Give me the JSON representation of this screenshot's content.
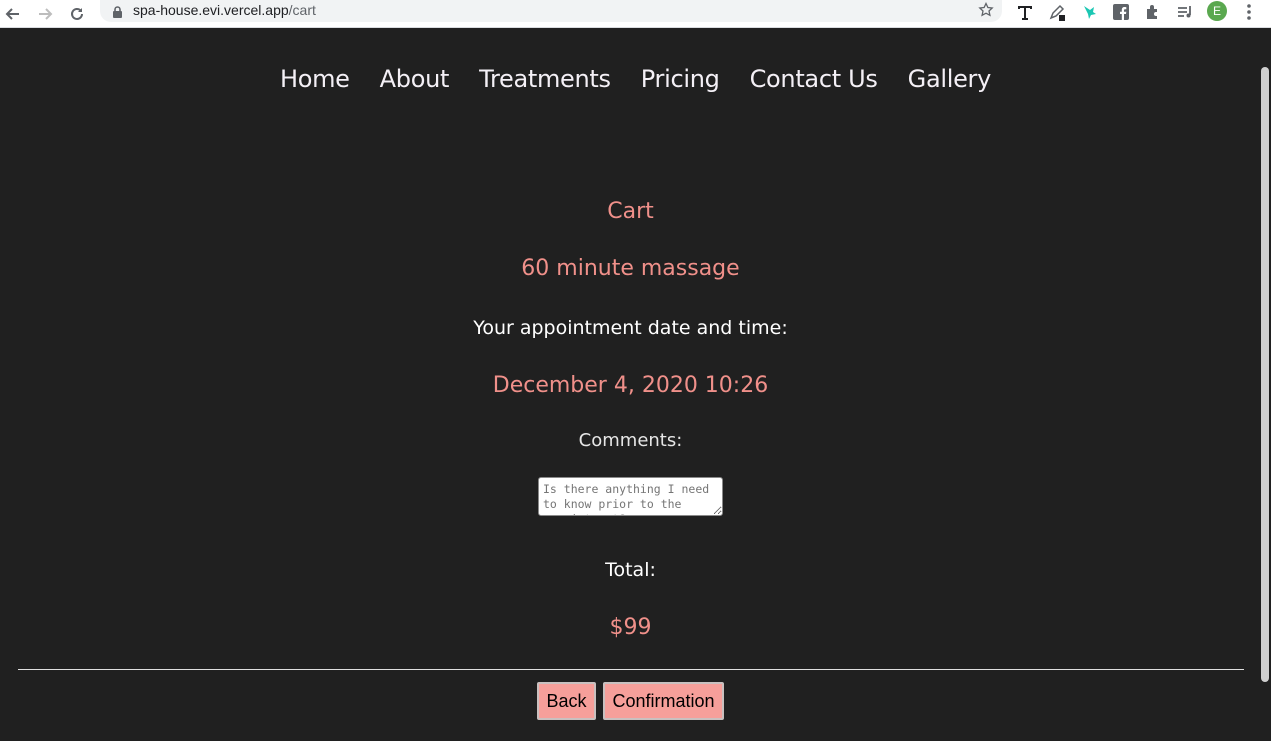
{
  "browser": {
    "url_host": "spa-house.evi.vercel.app",
    "url_path": "/cart",
    "profile_initial": "E",
    "icons": [
      "back-arrow-icon",
      "forward-arrow-icon",
      "reload-icon",
      "lock-icon",
      "star-icon",
      "text-extension-icon",
      "pen-extension-icon",
      "bird-extension-icon",
      "facebook-icon",
      "puzzle-extensions-icon",
      "media-queue-icon",
      "menu-dots-icon"
    ]
  },
  "nav": {
    "items": [
      "Home",
      "About",
      "Treatments",
      "Pricing",
      "Contact Us",
      "Gallery"
    ]
  },
  "cart": {
    "heading": "Cart",
    "service": "60 minute massage",
    "date_label": "Your appointment date and time:",
    "date_value": "December 4, 2020 10:26",
    "comments_label": "Comments:",
    "comments_placeholder": "Is there anything I need to know prior to the appointment?",
    "total_label": "Total:",
    "total_value": "$99"
  },
  "actions": {
    "back_label": "Back",
    "confirm_label": "Confirmation"
  },
  "colors": {
    "background": "#202020",
    "accent": "#f0908a",
    "button": "#f69f9a"
  }
}
